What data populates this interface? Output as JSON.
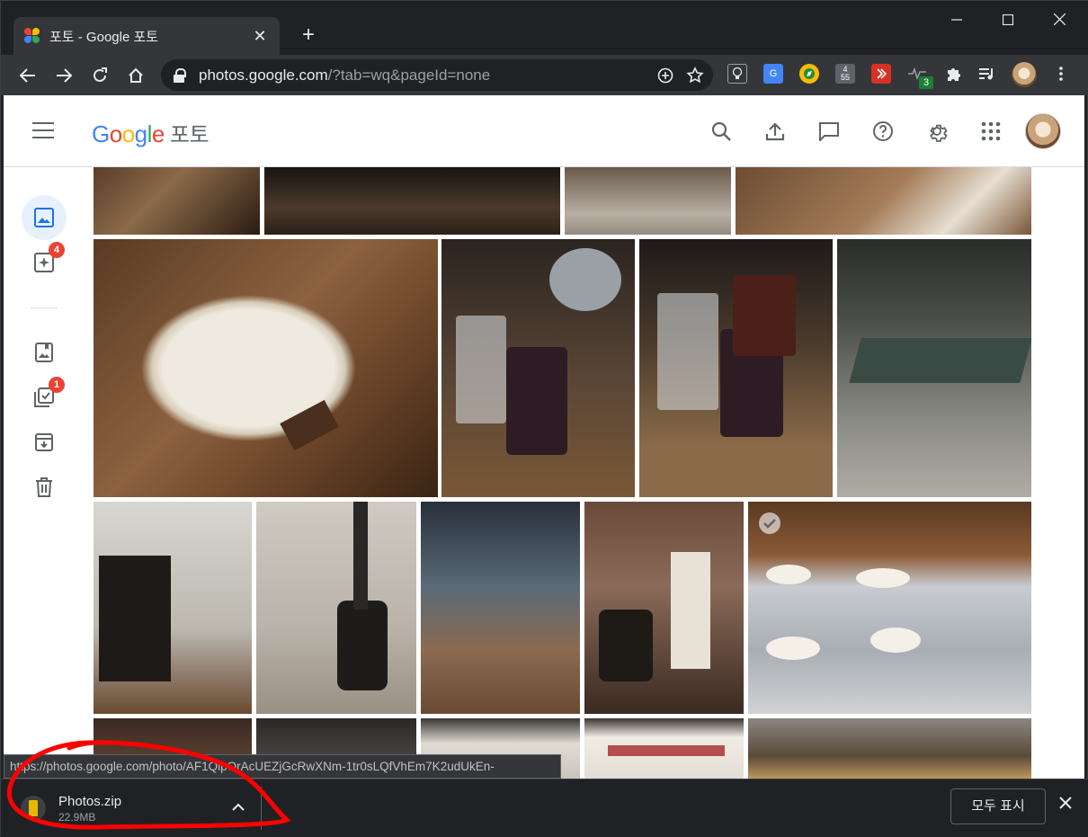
{
  "browser": {
    "tab_title": "포토 - Google 포토",
    "new_tab": "+",
    "url_host": "photos.google.com",
    "url_rest": "/?tab=wq&pageId=none",
    "window_controls": {
      "minimize": "—",
      "maximize": "☐",
      "close": "✕"
    },
    "extensions": [
      {
        "name": "bulb-ext-icon",
        "label": "💡",
        "color": "#5f6368"
      },
      {
        "name": "translate-ext-icon",
        "label": "G",
        "color": "#4285f4"
      },
      {
        "name": "compass-ext-icon",
        "label": "◎",
        "color": "#fbbc04"
      },
      {
        "name": "counter-ext-icon",
        "label": "4\n55",
        "color": "#5f6368"
      },
      {
        "name": "red-play-ext-icon",
        "label": "▶",
        "color": "#d93025"
      },
      {
        "name": "pulse-ext-icon",
        "label": "~",
        "color": "#35363a"
      }
    ],
    "ext_badge": "3"
  },
  "app": {
    "logo_letters": [
      {
        "ch": "G",
        "color": "#4285f4"
      },
      {
        "ch": "o",
        "color": "#ea4335"
      },
      {
        "ch": "o",
        "color": "#fbbc04"
      },
      {
        "ch": "g",
        "color": "#4285f4"
      },
      {
        "ch": "l",
        "color": "#34a853"
      },
      {
        "ch": "e",
        "color": "#ea4335"
      }
    ],
    "product_name": "포토",
    "sidenav_badges": {
      "assistant": "4",
      "utilities": "1"
    }
  },
  "status_url": "https://photos.google.com/photo/AF1QipOrAcUEZjGcRwXNm-1tr0sLQfVhEm7K2udUkEn-",
  "download": {
    "file_name": "Photos.zip",
    "file_size": "22.9MB",
    "show_all": "모두 표시"
  },
  "colors": {
    "accent": "#1a73e8",
    "badge": "#ea4335",
    "annotation": "#ff0000"
  }
}
